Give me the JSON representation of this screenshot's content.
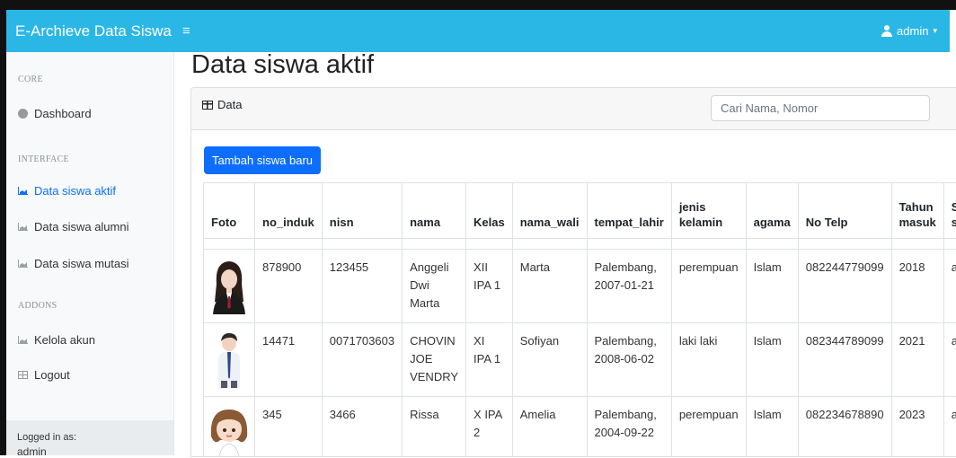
{
  "navbar": {
    "brand": "E-Archieve Data Siswa",
    "toggle_icon": "≡",
    "user": "admin"
  },
  "sidebar": {
    "heading_core": "CORE",
    "dashboard": "Dashboard",
    "heading_interface": "INTERFACE",
    "items": [
      "Data siswa aktif",
      "Data siswa alumni",
      "Data siswa mutasi"
    ],
    "heading_addons": "ADDONS",
    "kelola": "Kelola akun",
    "logout": "Logout",
    "footer_label": "Logged in as:",
    "footer_user": "admin"
  },
  "page": {
    "title": "Data siswa aktif"
  },
  "card": {
    "title": "Data",
    "search_placeholder": "Cari Nama, Nomor",
    "add_button": "Tambah siswa baru"
  },
  "table": {
    "headers": [
      "Foto",
      "no_induk",
      "nisn",
      "nama",
      "Kelas",
      "nama_wali",
      "tempat_lahir",
      "jenis kelamin",
      "agama",
      "No Telp",
      "Tahun masuk",
      "St si"
    ],
    "rows": [
      {
        "no_induk": "878900",
        "nisn": "123455",
        "nama": "Anggeli Dwi Marta",
        "kelas": "XII IPA 1",
        "nama_wali": "Marta",
        "tempat_lahir": "Palembang, 2007-01-21",
        "jenis_kelamin": "perempuan",
        "agama": "Islam",
        "no_telp": "082244779099",
        "tahun_masuk": "2018",
        "status": "ak"
      },
      {
        "no_induk": "14471",
        "nisn": "0071703603",
        "nama": "CHOVIN JOE VENDRY",
        "kelas": "XI IPA 1",
        "nama_wali": "Sofiyan",
        "tempat_lahir": "Palembang, 2008-06-02",
        "jenis_kelamin": "laki laki",
        "agama": "Islam",
        "no_telp": "082344789099",
        "tahun_masuk": "2021",
        "status": "ak"
      },
      {
        "no_induk": "345",
        "nisn": "3466",
        "nama": "Rissa",
        "kelas": "X IPA 2",
        "nama_wali": "Amelia",
        "tempat_lahir": "Palembang, 2004-09-22",
        "jenis_kelamin": "perempuan",
        "agama": "Islam",
        "no_telp": "082234678890",
        "tahun_masuk": "2023",
        "status": "ak"
      }
    ]
  },
  "colors": {
    "navbar": "#2bb7e6",
    "primary": "#0d6efd",
    "sidebar_bg": "#f8f9fa"
  }
}
